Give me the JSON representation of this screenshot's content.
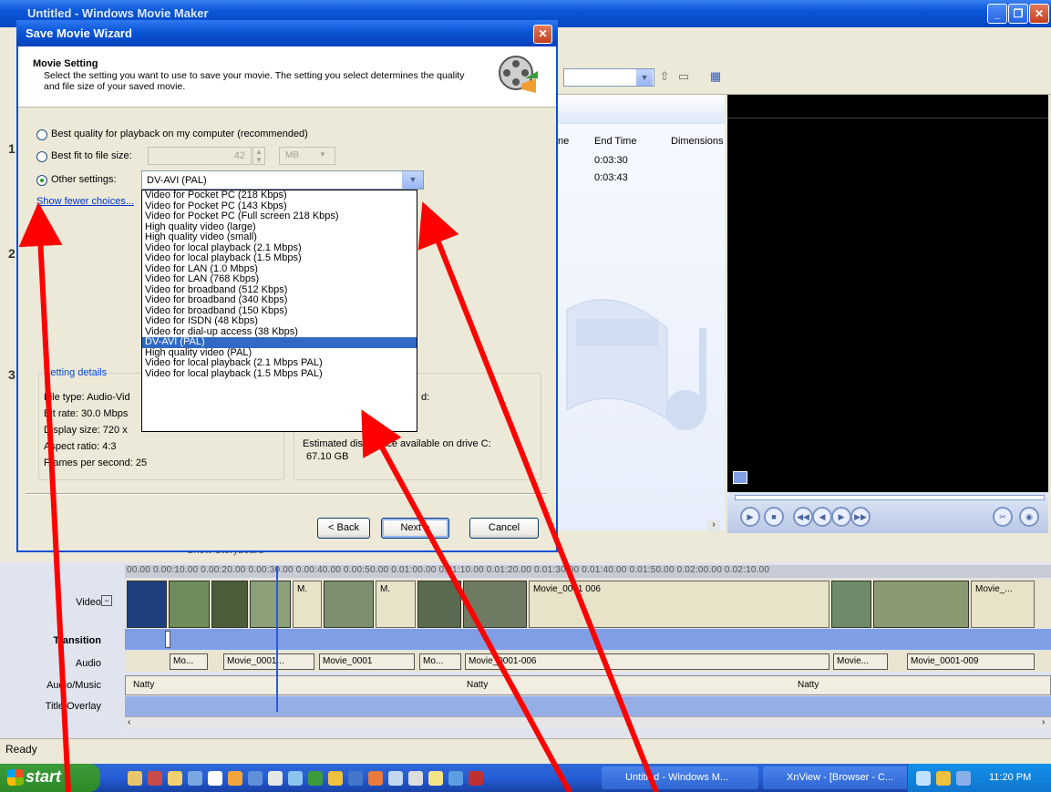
{
  "main_window": {
    "title": "Untitled - Windows Movie Maker",
    "minimize": "_",
    "maximize": "❐",
    "close": "✕"
  },
  "contents": {
    "columns": [
      "ne",
      "End Time",
      "Dimensions"
    ],
    "rows": [
      {
        "end_time": "0:03:30"
      },
      {
        "end_time": "0:03:43"
      }
    ]
  },
  "side_numbers": [
    "1",
    "2",
    "3"
  ],
  "timeline": {
    "story_label": "Show Storyboard",
    "ruler": "00.00   0.00:10.00   0.00:20.00   0.00:30.00   0.00:40.00   0.00:50.00   0.01:00.00   0.01:10.00   0.01:20.00   0.01:30.00   0.01:40.00   0.01:50.00   0.02:00.00   0.02:10.00",
    "tracks": {
      "video": "Video",
      "transition": "Transition",
      "audio": "Audio",
      "audio_music": "Audio/Music",
      "title_overlay": "Title Overlay"
    },
    "video_clips": [
      "M.",
      "M.",
      "Movie_0001 006",
      "Movie_..."
    ],
    "audio_clips": [
      "Mo...",
      "Movie_0001...",
      "Movie_0001",
      "Mo...",
      "Movie_0001-006",
      "Movie...",
      "Movie_0001-009"
    ],
    "music_clips": [
      "Natty",
      "Natty",
      "Natty"
    ]
  },
  "status": {
    "text": "Ready"
  },
  "taskbar": {
    "start": "start",
    "tasks": [
      "Untitled - Windows M...",
      "XnView - [Browser - C..."
    ],
    "clock": "11:20 PM"
  },
  "dialog": {
    "title": "Save Movie Wizard",
    "close": "✕",
    "header_title": "Movie Setting",
    "header_desc": "Select the setting you want to use to save your movie. The setting you select determines the quality and file size of your saved movie.",
    "options": {
      "best_quality": "Best quality for playback on my computer (recommended)",
      "best_fit": "Best fit to file size:",
      "other": "Other settings:"
    },
    "size_value": "42",
    "size_unit": "MB",
    "selected_setting": "DV-AVI (PAL)",
    "fewer_link": "Show fewer choices...",
    "dropdown_items": [
      "Video for Pocket PC (218 Kbps)",
      "Video for Pocket PC (143 Kbps)",
      "Video for Pocket PC (Full screen 218 Kbps)",
      "High quality video (large)",
      "High quality video (small)",
      "Video for local playback (2.1 Mbps)",
      "Video for local playback (1.5 Mbps)",
      "Video for LAN (1.0 Mbps)",
      "Video for LAN (768 Kbps)",
      "Video for broadband (512 Kbps)",
      "Video for broadband (340 Kbps)",
      "Video for broadband (150 Kbps)",
      "Video for ISDN (48 Kbps)",
      "Video for dial-up access (38 Kbps)",
      "DV-AVI (PAL)",
      "High quality video (PAL)",
      "Video for local playback (2.1 Mbps PAL)",
      "Video for local playback (1.5 Mbps PAL)"
    ],
    "selected_index": 14,
    "details": {
      "legend": "Setting details",
      "file_type": "File type: Audio-Vid",
      "bit_rate": "Bit rate: 30.0 Mbps",
      "display_size": "Display size: 720 x",
      "aspect_ratio": "Aspect ratio: 4:3",
      "fps": "Frames per second: 25"
    },
    "estimate": {
      "partial": "d:",
      "disk_label": "Estimated disk space available on drive C:",
      "disk_value": "67.10 GB"
    },
    "buttons": {
      "back": "< Back",
      "next": "Next >",
      "cancel": "Cancel"
    }
  },
  "colors": {
    "xp_blue": "#0a56d8",
    "annotation_arrow": "#ff0000",
    "selection": "#316ac5"
  }
}
